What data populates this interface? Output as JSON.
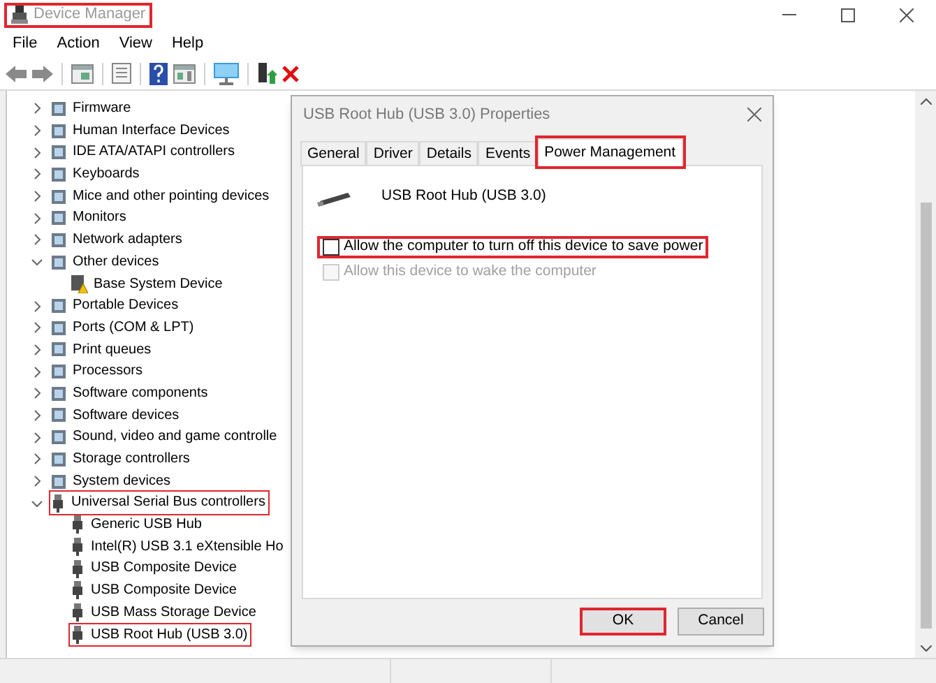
{
  "window": {
    "title": "Device Manager",
    "highlighted": true
  },
  "menu": [
    "File",
    "Action",
    "View",
    "Help"
  ],
  "tree": [
    {
      "label": "Firmware",
      "expanded": false,
      "highlighted": false
    },
    {
      "label": "Human Interface Devices",
      "expanded": false,
      "highlighted": false
    },
    {
      "label": "IDE ATA/ATAPI controllers",
      "expanded": false,
      "highlighted": false
    },
    {
      "label": "Keyboards",
      "expanded": false,
      "highlighted": false
    },
    {
      "label": "Mice and other pointing devices",
      "expanded": false,
      "highlighted": false
    },
    {
      "label": "Monitors",
      "expanded": false,
      "highlighted": false
    },
    {
      "label": "Network adapters",
      "expanded": false,
      "highlighted": false
    },
    {
      "label": "Other devices",
      "expanded": true,
      "highlighted": false,
      "children": [
        {
          "label": "Base System Device",
          "warning": true,
          "highlighted": false
        }
      ]
    },
    {
      "label": "Portable Devices",
      "expanded": false,
      "highlighted": false
    },
    {
      "label": "Ports (COM & LPT)",
      "expanded": false,
      "highlighted": false
    },
    {
      "label": "Print queues",
      "expanded": false,
      "highlighted": false
    },
    {
      "label": "Processors",
      "expanded": false,
      "highlighted": false
    },
    {
      "label": "Software components",
      "expanded": false,
      "highlighted": false
    },
    {
      "label": "Software devices",
      "expanded": false,
      "highlighted": false
    },
    {
      "label": "Sound, video and game controlle",
      "expanded": false,
      "highlighted": false
    },
    {
      "label": "Storage controllers",
      "expanded": false,
      "highlighted": false
    },
    {
      "label": "System devices",
      "expanded": false,
      "highlighted": false
    },
    {
      "label": "Universal Serial Bus controllers",
      "expanded": true,
      "highlighted": true,
      "children": [
        {
          "label": "Generic USB Hub",
          "warning": false,
          "highlighted": false
        },
        {
          "label": "Intel(R) USB 3.1 eXtensible Ho",
          "warning": false,
          "highlighted": false
        },
        {
          "label": "USB Composite Device",
          "warning": false,
          "highlighted": false
        },
        {
          "label": "USB Composite Device",
          "warning": false,
          "highlighted": false
        },
        {
          "label": "USB Mass Storage Device",
          "warning": false,
          "highlighted": false
        },
        {
          "label": "USB Root Hub (USB 3.0)",
          "warning": false,
          "highlighted": true
        }
      ]
    }
  ],
  "dialog": {
    "title": "USB Root Hub (USB 3.0) Properties",
    "tabs": [
      {
        "label": "General",
        "selected": false,
        "highlighted": false
      },
      {
        "label": "Driver",
        "selected": false,
        "highlighted": false
      },
      {
        "label": "Details",
        "selected": false,
        "highlighted": false
      },
      {
        "label": "Events",
        "selected": false,
        "highlighted": false
      },
      {
        "label": "Power Management",
        "selected": true,
        "highlighted": true
      }
    ],
    "device_name": "USB Root Hub (USB 3.0)",
    "options": [
      {
        "label": "Allow the computer to turn off this device to save power",
        "checked": false,
        "disabled": false,
        "highlighted": true
      },
      {
        "label": "Allow this device to wake the computer",
        "checked": false,
        "disabled": true,
        "highlighted": false
      }
    ],
    "buttons": [
      {
        "label": "OK",
        "highlighted": true
      },
      {
        "label": "Cancel",
        "highlighted": false
      }
    ]
  }
}
